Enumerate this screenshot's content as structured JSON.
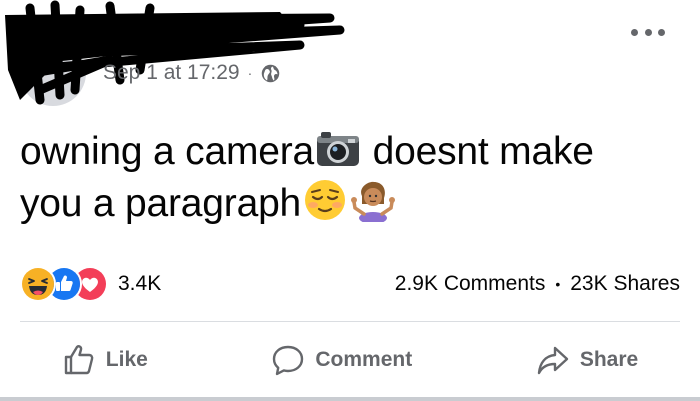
{
  "post": {
    "timestamp": "Sep 1 at 17:29",
    "separator": "·",
    "privacy_icon": "globe-icon",
    "text": {
      "line1_a": "owning a camera",
      "line1_b": " doesnt make",
      "line2": "you a paragraph"
    },
    "emojis": [
      "camera-emoji",
      "relieved-face-emoji",
      "woman-shrugging-emoji"
    ]
  },
  "reactions": {
    "icons": [
      "haha-reaction-icon",
      "like-reaction-icon",
      "love-reaction-icon"
    ],
    "count": "3.4K"
  },
  "stats": {
    "comments": "2.9K Comments",
    "separator": "•",
    "shares": "23K Shares"
  },
  "actions": {
    "like": "Like",
    "comment": "Comment",
    "share": "Share"
  },
  "colors": {
    "secondary_text": "#65676b",
    "like_blue": "#1877f2",
    "love_red": "#f33e58",
    "haha_yellow": "#f7b125"
  }
}
